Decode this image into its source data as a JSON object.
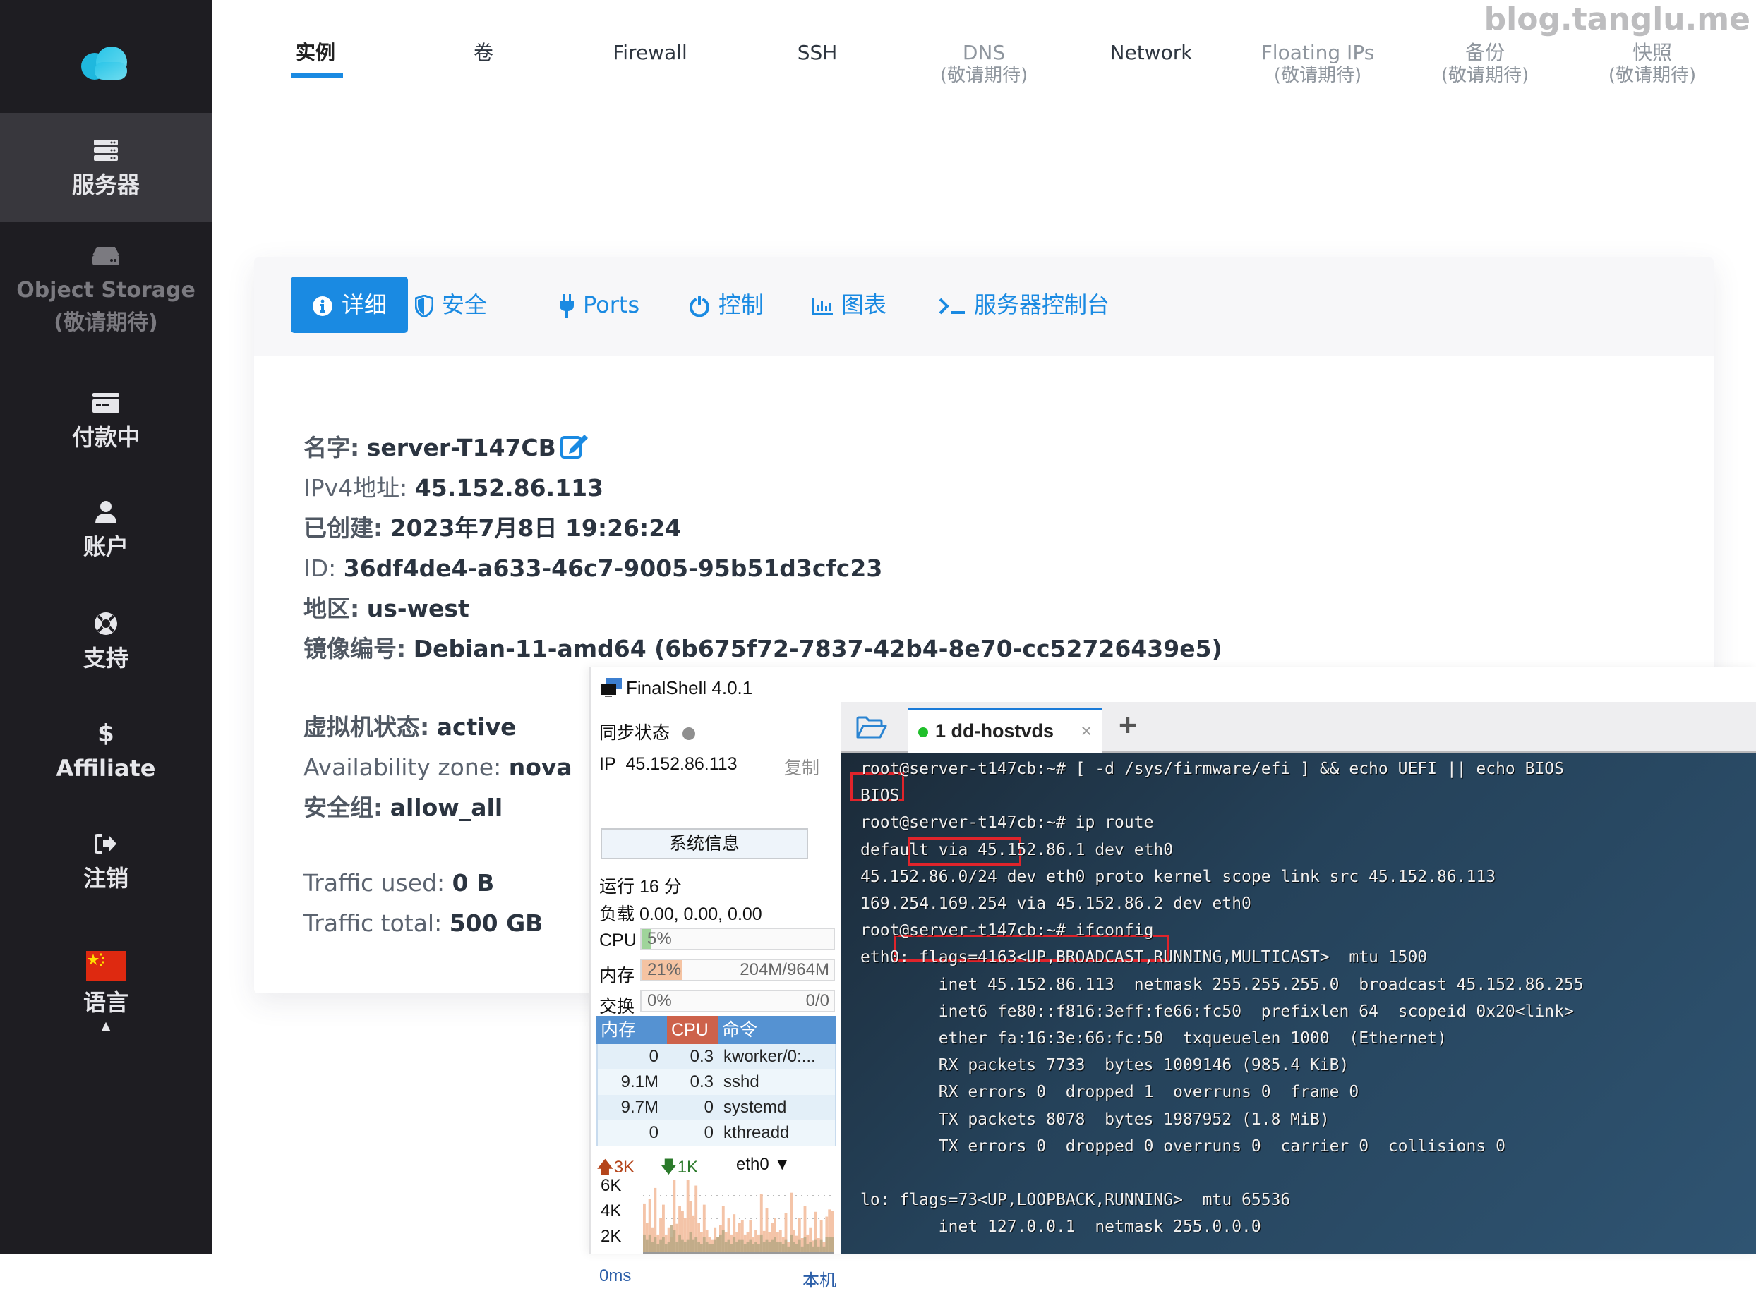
{
  "watermark": "blog.tanglu.me",
  "sidebar": {
    "items": [
      {
        "label": "服务器",
        "icon": "server-icon",
        "active": true
      },
      {
        "label": "Object Storage",
        "sub": "(敬请期待)",
        "icon": "hdd-icon",
        "disabled": true
      },
      {
        "label": "付款中",
        "icon": "credit-card-icon"
      },
      {
        "label": "账户",
        "icon": "user-icon"
      },
      {
        "label": "支持",
        "icon": "life-ring-icon"
      },
      {
        "label": "Affiliate",
        "icon": "dollar-icon"
      },
      {
        "label": "注销",
        "icon": "sign-out-icon"
      },
      {
        "label": "语言",
        "icon": "china-flag-icon",
        "caret": "▲"
      }
    ]
  },
  "topnav": {
    "items": [
      {
        "label": "实例",
        "active": true
      },
      {
        "label": "卷"
      },
      {
        "label": "Firewall"
      },
      {
        "label": "SSH"
      },
      {
        "label": "DNS",
        "sub": "(敬请期待)",
        "muted": true
      },
      {
        "label": "Network"
      },
      {
        "label": "Floating IPs",
        "sub": "(敬请期待)",
        "muted": true
      },
      {
        "label": "备份",
        "sub": "(敬请期待)",
        "muted": true
      },
      {
        "label": "快照",
        "sub": "(敬请期待)",
        "muted": true
      }
    ]
  },
  "card": {
    "tabs": [
      {
        "label": "详细",
        "icon": "info-circle-icon",
        "active": true
      },
      {
        "label": "安全",
        "icon": "shield-icon"
      },
      {
        "label": "Ports",
        "icon": "plug-icon"
      },
      {
        "label": "控制",
        "icon": "power-icon"
      },
      {
        "label": "图表",
        "icon": "bar-chart-icon"
      },
      {
        "label": "服务器控制台",
        "icon": "terminal-icon"
      }
    ],
    "details": {
      "name_key": "名字:",
      "name": "server-T147CB",
      "ipv4_key": "IPv4地址:",
      "ipv4": "45.152.86.113",
      "created_key": "已创建:",
      "created": "2023年7月8日 19:26:24",
      "id_key": "ID:",
      "id": "36df4de4-a633-46c7-9005-95b51d3cfc23",
      "region_key": "地区:",
      "region": "us-west",
      "image_key": "镜像编号:",
      "image": "Debian-11-amd64 (6b675f72-7837-42b4-8e70-cc52726439e5)",
      "vm_state_key": "虚拟机状态:",
      "vm_state": "active",
      "az_key": "Availability zone:",
      "az": "nova",
      "secgroup_key": "安全组:",
      "secgroup": "allow_all",
      "traffic_used_key": "Traffic used:",
      "traffic_used": "0 B",
      "traffic_total_key": "Traffic total:",
      "traffic_total": "500 GB"
    }
  },
  "finalshell": {
    "title": "FinalShell 4.0.1",
    "sync_label": "同步状态",
    "ip_label": "IP",
    "ip": "45.152.86.113",
    "copy_label": "复制",
    "sysinfo_button": "系统信息",
    "uptime": "运行 16 分",
    "load": "负载 0.00, 0.00, 0.00",
    "cpu": {
      "label": "CPU",
      "percent": 5,
      "text": "5%"
    },
    "mem": {
      "label": "内存",
      "percent": 21,
      "text": "21%",
      "amount": "204M/964M"
    },
    "swap": {
      "label": "交换",
      "percent": 0,
      "text": "0%",
      "amount": "0/0"
    },
    "process_table": {
      "headers": [
        "内存",
        "CPU",
        "命令"
      ],
      "rows": [
        {
          "mem": "0",
          "cpu": "0.3",
          "cmd": "kworker/0:..."
        },
        {
          "mem": "9.1M",
          "cpu": "0.3",
          "cmd": "sshd"
        },
        {
          "mem": "9.7M",
          "cpu": "0",
          "cmd": "systemd"
        },
        {
          "mem": "0",
          "cpu": "0",
          "cmd": "kthreadd"
        }
      ]
    },
    "network": {
      "upload": "3K",
      "download": "1K",
      "interface": "eth0",
      "y_labels": [
        "6K",
        "4K",
        "2K"
      ],
      "latency": "0ms",
      "local_label": "本机",
      "upload_series": [
        4.2,
        2.6,
        4.6,
        2.2,
        5.5,
        1.6,
        3.0,
        4.1,
        1.6,
        2.2,
        1.4,
        6.2,
        2.5,
        4.0,
        3.6,
        3.0,
        6.2,
        4.4,
        3.2,
        5.7,
        2.6,
        1.8,
        4.1,
        2.0,
        1.4,
        1.2,
        2.2,
        1.4,
        2.4,
        4.0,
        1.8,
        3.0,
        1.6,
        3.3,
        1.8,
        2.6,
        2.8,
        1.6,
        1.8,
        2.8,
        1.4,
        2.0,
        1.6,
        5.0,
        1.9,
        3.8,
        1.8,
        2.6,
        3.0,
        1.8,
        2.0,
        1.4,
        3.4,
        1.0,
        5.1,
        2.0,
        1.5,
        3.0,
        1.3,
        4.0,
        1.6,
        2.2,
        1.1,
        3.5,
        1.3,
        2.8,
        1.0,
        3.1,
        3.7,
        3.6
      ],
      "download_series": [
        1.6,
        1.2,
        1.6,
        1.0,
        1.4,
        0.8,
        1.2,
        1.4,
        0.8,
        1.0,
        2.4,
        2.0,
        1.0,
        1.6,
        1.2,
        1.0,
        1.2,
        1.8,
        1.2,
        1.4,
        1.0,
        0.8,
        1.4,
        1.0,
        0.8,
        0.8,
        1.2,
        1.4,
        1.6,
        2.0,
        1.0,
        1.2,
        0.8,
        1.4,
        1.0,
        1.2,
        1.2,
        0.8,
        1.0,
        1.2,
        0.8,
        1.0,
        0.8,
        1.6,
        1.0,
        1.2,
        1.0,
        1.2,
        1.4,
        1.0,
        1.0,
        0.8,
        1.2,
        0.6,
        1.6,
        1.0,
        0.8,
        1.2,
        0.6,
        1.4,
        0.8,
        1.0,
        0.6,
        1.2,
        0.6,
        1.2,
        0.6,
        1.4,
        1.4,
        1.4
      ],
      "y_max": 6.5
    },
    "terminal": {
      "tab_label": "1 dd-hostvds",
      "tab_status_color": "#1fbf2a",
      "lines": [
        "root@server-t147cb:~# [ -d /sys/firmware/efi ] && echo UEFI || echo BIOS",
        "BIOS",
        "root@server-t147cb:~# ip route",
        "default via 45.152.86.1 dev eth0",
        "45.152.86.0/24 dev eth0 proto kernel scope link src 45.152.86.113",
        "169.254.169.254 via 45.152.86.2 dev eth0",
        "root@server-t147cb:~# ifconfig",
        "eth0: flags=4163<UP,BROADCAST,RUNNING,MULTICAST>  mtu 1500",
        "        inet 45.152.86.113  netmask 255.255.255.0  broadcast 45.152.86.255",
        "        inet6 fe80::f816:3eff:fe66:fc50  prefixlen 64  scopeid 0x20<link>",
        "        ether fa:16:3e:66:fc:50  txqueuelen 1000  (Ethernet)",
        "        RX packets 7733  bytes 1009146 (985.4 KiB)",
        "        RX errors 0  dropped 1  overruns 0  frame 0",
        "        TX packets 8078  bytes 1987952 (1.8 MiB)",
        "        TX errors 0  dropped 0 overruns 0  carrier 0  collisions 0",
        "",
        "lo: flags=73<UP,LOOPBACK,RUNNING>  mtu 65536",
        "        inet 127.0.0.1  netmask 255.0.0.0"
      ]
    }
  },
  "colors": {
    "accent": "#1a8ae2",
    "sidebar_bg": "#1e1d22",
    "sidebar_active": "#38373d",
    "highlight_box": "#e0242b",
    "cpu_fill": "#9fd49a",
    "mem_fill": "#f5c3a2",
    "upload_bar": "#f4c4a8",
    "download_bar": "#b8a884"
  }
}
